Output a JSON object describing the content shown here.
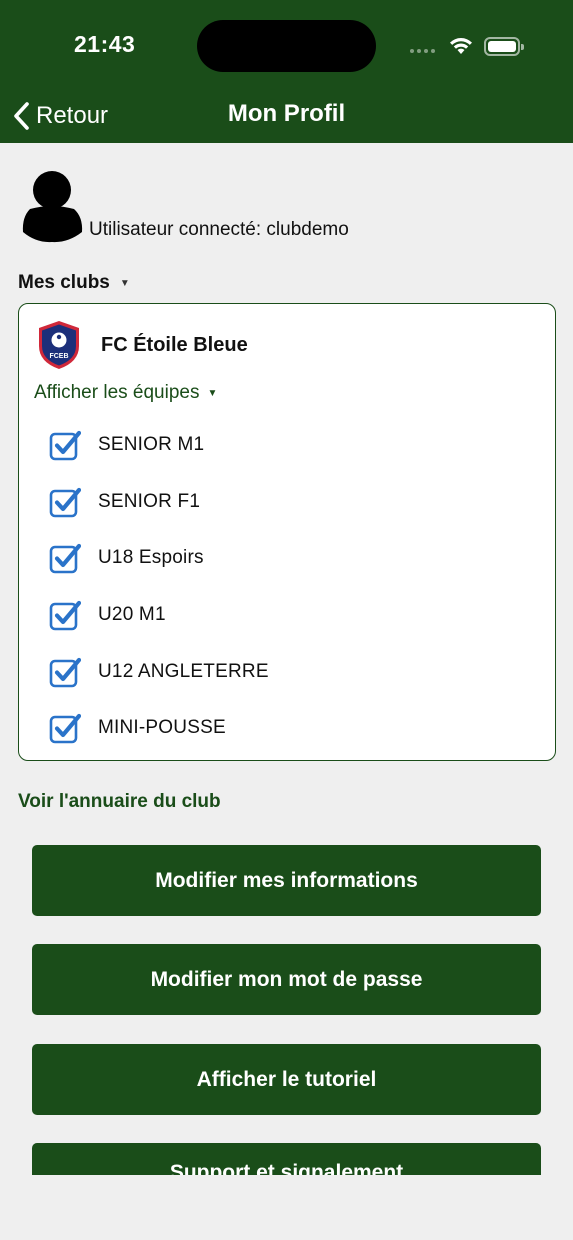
{
  "status_bar": {
    "time": "21:43"
  },
  "nav": {
    "back_label": "Retour",
    "title": "Mon Profil"
  },
  "user": {
    "connected_text": "Utilisateur connecté: clubdemo"
  },
  "clubs_section": {
    "label": "Mes clubs",
    "club": {
      "name": "FC Étoile Bleue",
      "logo_text": "FCEB",
      "show_teams_label": "Afficher les équipes",
      "teams": [
        {
          "name": "SENIOR M1",
          "checked": true
        },
        {
          "name": "SENIOR F1",
          "checked": true
        },
        {
          "name": "U18 Espoirs",
          "checked": true
        },
        {
          "name": "U20 M1",
          "checked": true
        },
        {
          "name": "U12 ANGLETERRE",
          "checked": true
        },
        {
          "name": "MINI-POUSSE",
          "checked": true
        }
      ]
    }
  },
  "directory_link": "Voir l'annuaire du club",
  "buttons": {
    "edit_info": "Modifier mes informations",
    "edit_password": "Modifier mon mot de passe",
    "tutorial": "Afficher le tutoriel",
    "support": "Support et signalement"
  },
  "colors": {
    "brand_green": "#1a4d19",
    "checkbox_blue": "#2a73c9",
    "logo_navy": "#1c2f7a",
    "logo_red": "#d0283a",
    "background": "#efefef"
  },
  "icons": {
    "back": "chevron-left-icon",
    "user": "user-silhouette-icon",
    "wifi": "wifi-icon",
    "battery": "battery-icon",
    "checkbox": "checkbox-checked-icon"
  }
}
